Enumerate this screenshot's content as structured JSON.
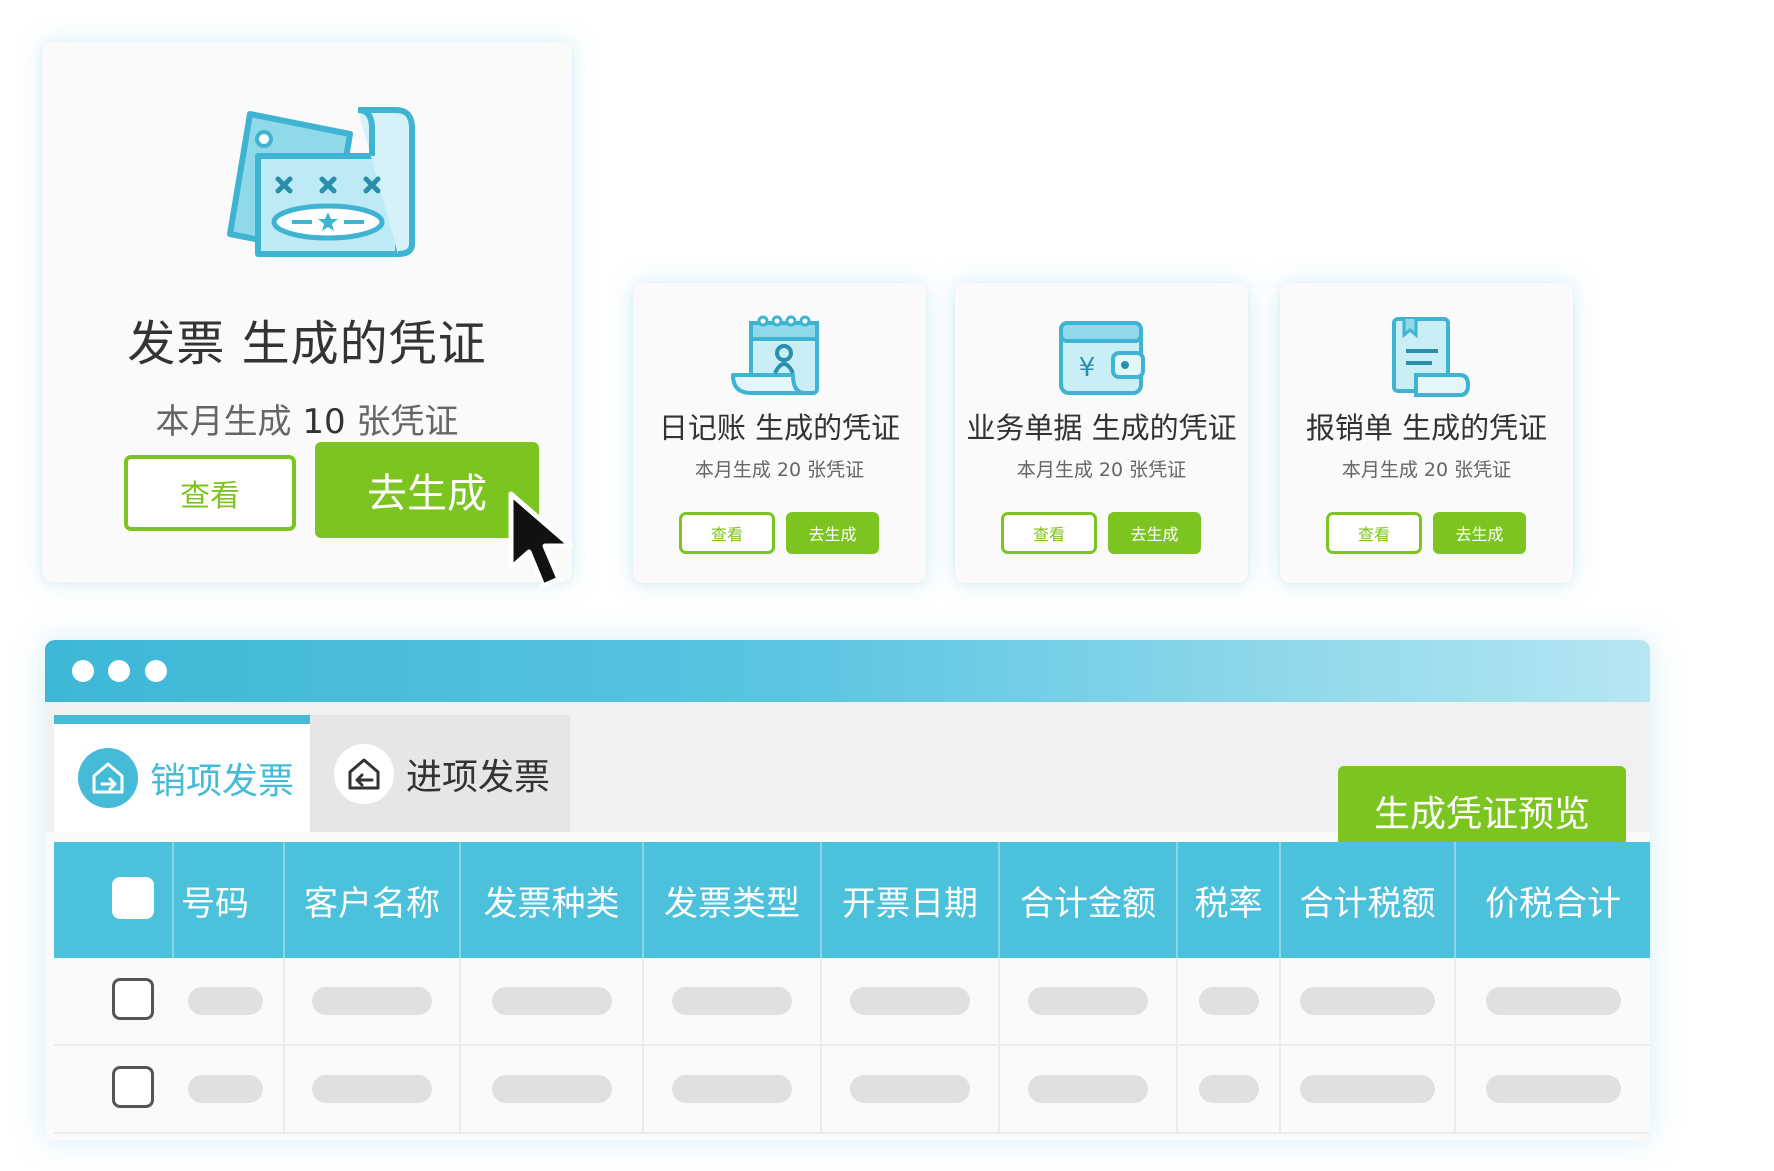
{
  "main_card": {
    "title": "发票 生成的凭证",
    "sub_prefix": "本月生成",
    "sub_count": "10",
    "sub_suffix": "张凭证",
    "view_label": "查看",
    "generate_label": "去生成"
  },
  "small_cards": [
    {
      "title": "日记账 生成的凭证",
      "subtitle": "本月生成 20 张凭证",
      "view_label": "查看",
      "generate_label": "去生成"
    },
    {
      "title": "业务单据 生成的凭证",
      "subtitle": "本月生成 20 张凭证",
      "view_label": "查看",
      "generate_label": "去生成"
    },
    {
      "title": "报销单 生成的凭证",
      "subtitle": "本月生成 20 张凭证",
      "view_label": "查看",
      "generate_label": "去生成"
    }
  ],
  "window": {
    "tabs": [
      {
        "label": "销项发票",
        "active": true
      },
      {
        "label": "进项发票",
        "active": false
      }
    ],
    "preview_button": "生成凭证预览",
    "table": {
      "columns": [
        "号码",
        "客户名称",
        "发票种类",
        "发票类型",
        "开票日期",
        "合计金额",
        "税率",
        "合计税额",
        "价税合计"
      ]
    }
  },
  "colors": {
    "accent_green": "#7cc520",
    "accent_blue": "#45bbd8",
    "header_blue": "#4cc1dc"
  }
}
